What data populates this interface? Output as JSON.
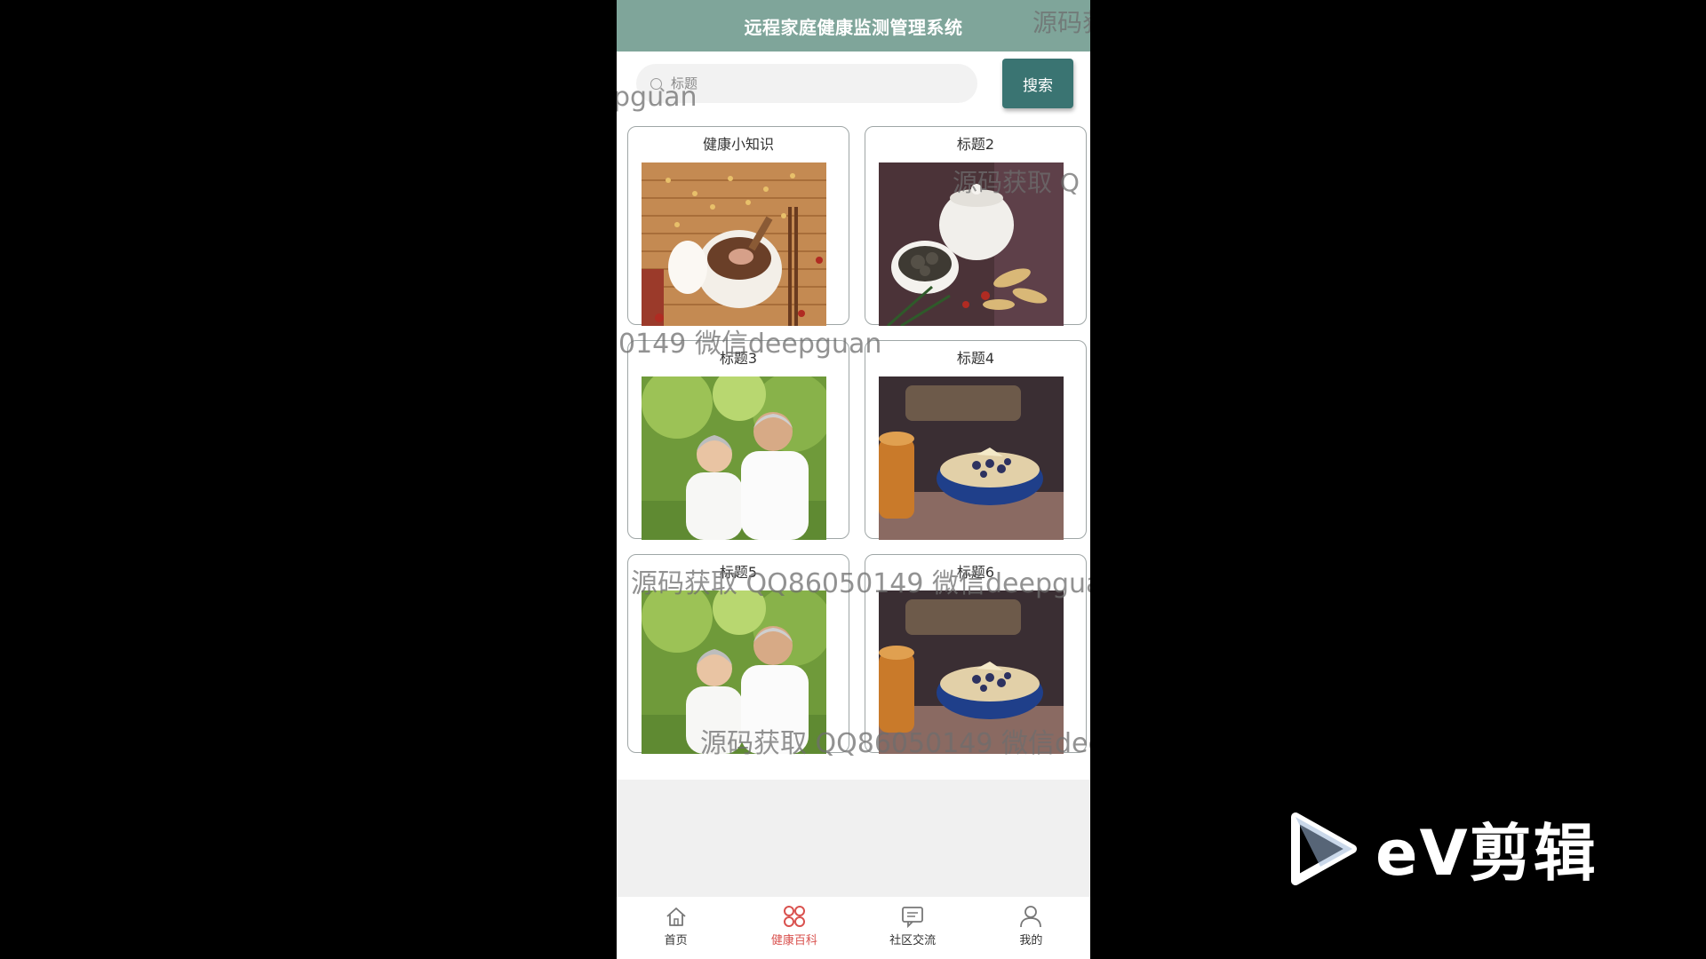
{
  "app": {
    "title": "远程家庭健康监测管理系统"
  },
  "search": {
    "placeholder": "标题",
    "button_label": "搜索"
  },
  "cards": [
    {
      "title": "健康小知识",
      "image": "herbal-soup-pot"
    },
    {
      "title": "标题2",
      "image": "dried-herbs-bowl"
    },
    {
      "title": "标题3",
      "image": "elderly-couple"
    },
    {
      "title": "标题4",
      "image": "oatmeal-bowl"
    },
    {
      "title": "标题5",
      "image": "elderly-couple"
    },
    {
      "title": "标题6",
      "image": "oatmeal-bowl"
    }
  ],
  "tabbar": [
    {
      "label": "首页",
      "icon": "home-icon",
      "active": false
    },
    {
      "label": "健康百科",
      "icon": "grid-icon",
      "active": true
    },
    {
      "label": "社区交流",
      "icon": "chat-icon",
      "active": false
    },
    {
      "label": "我的",
      "icon": "user-icon",
      "active": false
    }
  ],
  "watermarks": [
    "源码获",
    "pguan",
    "源码获取 Q",
    "0149 微信deepguan",
    "源码获取 QQ86050149 微信deepgua",
    "源码获取 QQ86050149 微信dee"
  ],
  "branding": {
    "logo_text": "eV剪辑",
    "accent": "#7fa59a",
    "button_color": "#3a7472",
    "active_color": "#d9514e"
  }
}
